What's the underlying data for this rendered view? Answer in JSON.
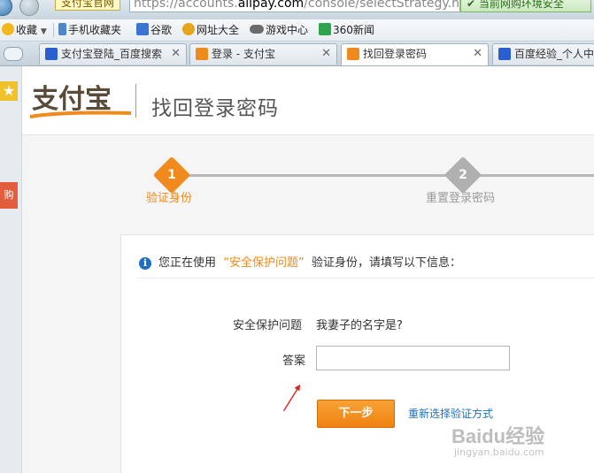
{
  "browser": {
    "site_badge": "支付宝官网",
    "url_prefix": "https://accounts.",
    "url_host": "alipay.com",
    "url_path": "/console/selectStrategy.ht",
    "safe_label": "当前网购环境安全"
  },
  "bookmarks": [
    {
      "label": "收藏",
      "icon": "star-plus-icon",
      "color": "#f3b71b"
    },
    {
      "label": "手机收藏夹",
      "icon": "phone-icon",
      "color": "#4f86c6"
    },
    {
      "label": "谷歌",
      "icon": "google-icon",
      "color": "#3b73d1"
    },
    {
      "label": "网址大全",
      "icon": "plus-globe-icon",
      "color": "#e6a51b"
    },
    {
      "label": "游戏中心",
      "icon": "gamepad-icon",
      "color": "#6c6c6c"
    },
    {
      "label": "360新闻",
      "icon": "360-icon",
      "color": "#2fa44f"
    }
  ],
  "tabs": [
    {
      "label": "支付宝登陆_百度搜索",
      "icon": "baidu-paw-icon",
      "color": "#2b5fcf"
    },
    {
      "label": "登录 - 支付宝",
      "icon": "alipay-icon",
      "color": "#f08a1c"
    },
    {
      "label": "找回登录密码",
      "icon": "alipay-icon",
      "color": "#f08a1c"
    },
    {
      "label": "百度经验_个人中",
      "icon": "baidu-paw-icon",
      "color": "#2b5fcf"
    }
  ],
  "rail": {
    "gift_label": "购"
  },
  "header": {
    "logo_text": "支付宝",
    "title": "找回登录密码"
  },
  "steps": [
    {
      "number": "1",
      "label": "验证身份",
      "state": "active"
    },
    {
      "number": "2",
      "label": "重置登录密码",
      "state": "pending"
    }
  ],
  "notice": {
    "prefix": "您正在使用",
    "highlight": "“安全保护问题”",
    "suffix": "验证身份，请填写以下信息："
  },
  "form": {
    "question_label": "安全保护问题",
    "question_value": "我妻子的名字是?",
    "answer_label": "答案",
    "answer_value": "",
    "next_button": "下一步",
    "reselect_link": "重新选择验证方式"
  },
  "watermark": {
    "main": "Baidu经验",
    "sub": "jingyan.baidu.com"
  },
  "colors": {
    "accent": "#f08a1c",
    "link": "#1c6fbf",
    "info": "#1f6fc4"
  }
}
